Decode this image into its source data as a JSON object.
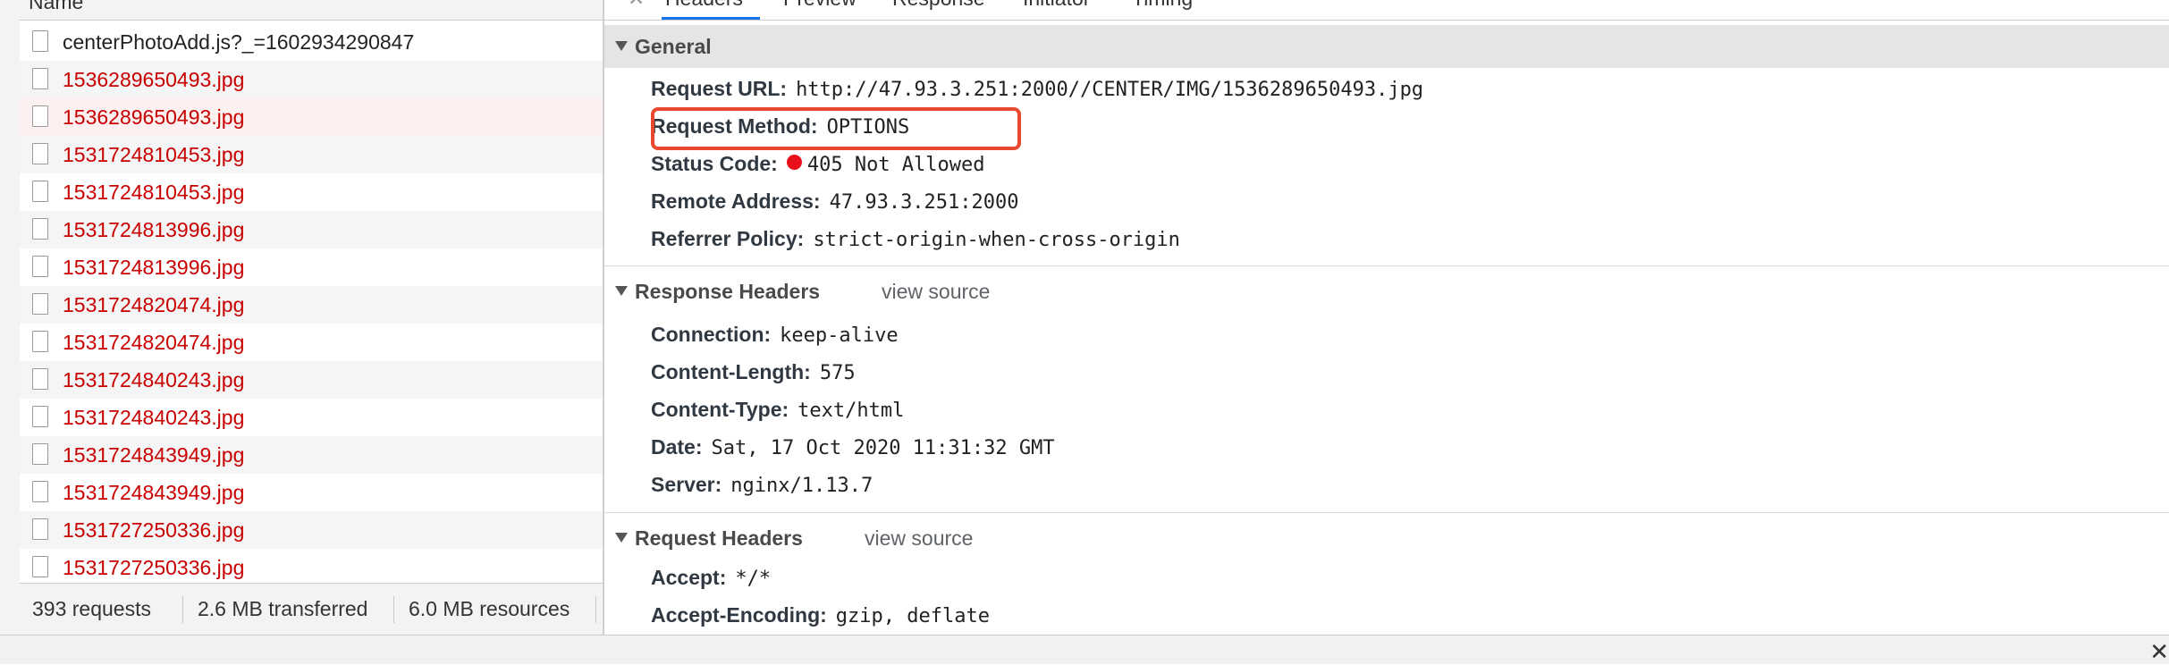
{
  "list": {
    "header": "Name",
    "rows": [
      {
        "name": "centerPhotoAdd.js?_=1602934290847",
        "status": "ok"
      },
      {
        "name": "1536289650493.jpg",
        "status": "error"
      },
      {
        "name": "1536289650493.jpg",
        "status": "error",
        "selected": true
      },
      {
        "name": "1531724810453.jpg",
        "status": "error"
      },
      {
        "name": "1531724810453.jpg",
        "status": "error"
      },
      {
        "name": "1531724813996.jpg",
        "status": "error"
      },
      {
        "name": "1531724813996.jpg",
        "status": "error"
      },
      {
        "name": "1531724820474.jpg",
        "status": "error"
      },
      {
        "name": "1531724820474.jpg",
        "status": "error"
      },
      {
        "name": "1531724840243.jpg",
        "status": "error"
      },
      {
        "name": "1531724840243.jpg",
        "status": "error"
      },
      {
        "name": "1531724843949.jpg",
        "status": "error"
      },
      {
        "name": "1531724843949.jpg",
        "status": "error"
      },
      {
        "name": "1531727250336.jpg",
        "status": "error"
      },
      {
        "name": "1531727250336.jpg",
        "status": "error"
      }
    ],
    "summary": {
      "requests": "393 requests",
      "transferred": "2.6 MB transferred",
      "resources": "6.0 MB resources"
    }
  },
  "tabs": [
    {
      "label": "Headers",
      "active": true
    },
    {
      "label": "Preview"
    },
    {
      "label": "Response"
    },
    {
      "label": "Initiator"
    },
    {
      "label": "Timing"
    }
  ],
  "general": {
    "title": "General",
    "request_url_key": "Request URL:",
    "request_url": "http://47.93.3.251:2000//CENTER/IMG/1536289650493.jpg",
    "request_method_key": "Request Method:",
    "request_method": "OPTIONS",
    "status_code_key": "Status Code:",
    "status_code": "405 Not Allowed",
    "remote_address_key": "Remote Address:",
    "remote_address": "47.93.3.251:2000",
    "referrer_policy_key": "Referrer Policy:",
    "referrer_policy": "strict-origin-when-cross-origin"
  },
  "response_headers": {
    "title": "Response Headers",
    "view_source": "view source",
    "items": [
      {
        "k": "Connection:",
        "v": "keep-alive"
      },
      {
        "k": "Content-Length:",
        "v": "575"
      },
      {
        "k": "Content-Type:",
        "v": "text/html"
      },
      {
        "k": "Date:",
        "v": "Sat, 17 Oct 2020 11:31:32 GMT"
      },
      {
        "k": "Server:",
        "v": "nginx/1.13.7"
      }
    ]
  },
  "request_headers": {
    "title": "Request Headers",
    "view_source": "view source",
    "items": [
      {
        "k": "Accept:",
        "v": "*/*"
      },
      {
        "k": "Accept-Encoding:",
        "v": "gzip, deflate"
      }
    ]
  },
  "colors": {
    "error_text": "#c80000",
    "status_dot": "#e8101a",
    "highlight_box": "#e8482e",
    "active_tab": "#1a73e8"
  },
  "icons": {
    "file": "file-icon",
    "expand": "triangle-down-icon",
    "close": "close-icon",
    "status": "status-error-dot-icon"
  },
  "bottom": {
    "close_glyph": "✕"
  }
}
